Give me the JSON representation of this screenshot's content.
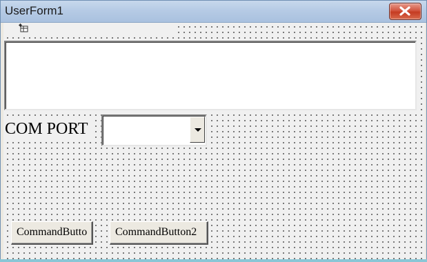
{
  "window": {
    "title": "UserForm1",
    "close_icon": "close-icon"
  },
  "form": {
    "toolbar_icon": "form-grid-icon",
    "text_box_value": "",
    "com_port_label": "COM PORT",
    "com_port_value": "",
    "dropdown_icon": "chevron-down-icon",
    "button1_label": "CommandButto",
    "button2_label": "CommandButton2"
  }
}
